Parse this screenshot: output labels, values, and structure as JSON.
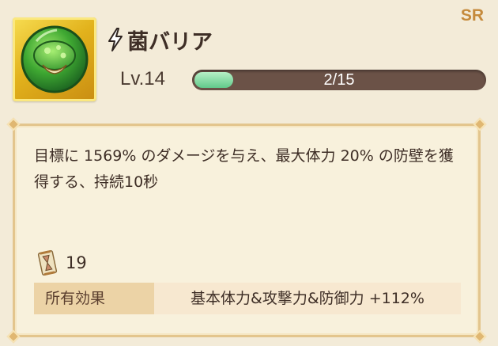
{
  "rarity": "SR",
  "skill": {
    "icon": "green-mushroom-shield-icon",
    "type_icon": "lightning-bolt-icon",
    "name": "菌バリア",
    "level_text": "Lv.14",
    "progress": {
      "text": "2/15",
      "current": 2,
      "max": 15
    }
  },
  "description": "目標に 1569% のダメージを与え、最大体力 20% の防壁を獲得する、持続10秒",
  "scroll": {
    "icon": "scroll-hourglass-icon",
    "count": "19"
  },
  "effect": {
    "label": "所有効果",
    "value": "基本体力&攻撃力&防御力 +112%"
  },
  "colors": {
    "rarity": "#c58a3c",
    "progress_fill": "#62c98a",
    "progress_track": "#6b5247",
    "panel_border": "#e3c58d"
  }
}
